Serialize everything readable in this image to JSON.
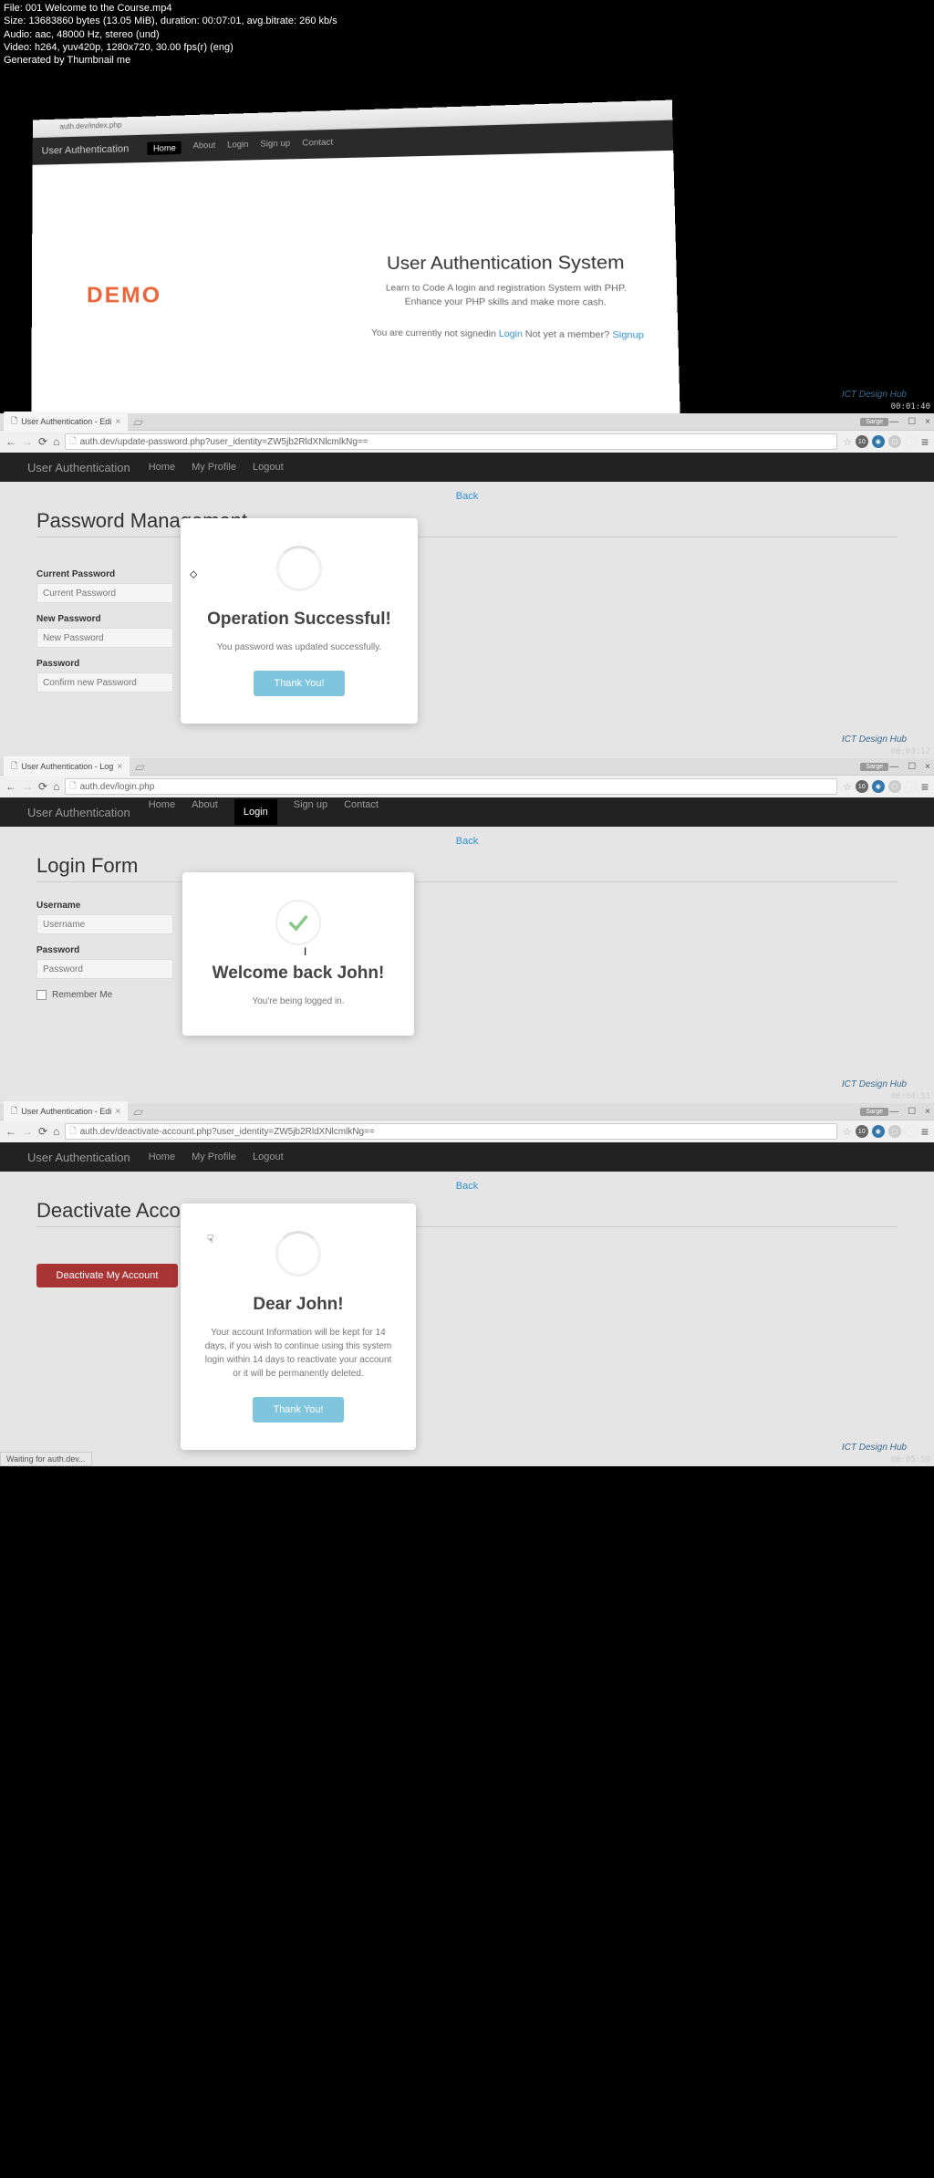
{
  "meta": {
    "file": "File: 001 Welcome to the Course.mp4",
    "size": "Size: 13683860 bytes (13.05 MiB), duration: 00:07:01, avg.bitrate: 260 kb/s",
    "audio": "Audio: aac, 48000 Hz, stereo (und)",
    "video": "Video: h264, yuv420p, 1280x720, 30.00 fps(r) (eng)",
    "gen": "Generated by Thumbnail me"
  },
  "frame1": {
    "url_suffix": "auth.dev/index.php",
    "brand": "User Authentication",
    "nav": {
      "home": "Home",
      "about": "About",
      "login": "Login",
      "signup": "Sign up",
      "contact": "Contact"
    },
    "demo": "DEMO",
    "title": "User Authentication System",
    "sub1": "Learn to Code A login and registration System with PHP.",
    "sub2": "Enhance your PHP skills and make more cash.",
    "status_pre": "You are currently not signedin ",
    "login_link": "Login",
    "status_mid": " Not yet a member? ",
    "signup_link": "Signup",
    "watermark": "ICT Design Hub",
    "timestamp": "00:01:40"
  },
  "frame2": {
    "tab_title": "User Authentication - Edi",
    "sarge": "Sarge",
    "url": "auth.dev/update-password.php?user_identity=ZW5jb2RldXNlcmlkNg==",
    "brand": "User Authentication",
    "nav": {
      "home": "Home",
      "profile": "My Profile",
      "logout": "Logout"
    },
    "back": "Back",
    "heading": "Password Management",
    "labels": {
      "current": "Current Password",
      "new": "New Password",
      "confirm": "Password"
    },
    "placeholders": {
      "current": "Current Password",
      "new": "New Password",
      "confirm": "Confirm new Password"
    },
    "modal": {
      "title": "Operation Successful!",
      "text": "You password was updated successfully.",
      "btn": "Thank You!"
    },
    "watermark": "ICT Design Hub",
    "timestamp": "00:03:12"
  },
  "frame3": {
    "tab_title": "User Authentication - Log",
    "sarge": "Sarge",
    "url": "auth.dev/login.php",
    "brand": "User Authentication",
    "nav": {
      "home": "Home",
      "about": "About",
      "login": "Login",
      "signup": "Sign up",
      "contact": "Contact"
    },
    "back": "Back",
    "heading": "Login Form",
    "labels": {
      "user": "Username",
      "pass": "Password",
      "remember": "Remember Me"
    },
    "placeholders": {
      "user": "Username",
      "pass": "Password"
    },
    "modal": {
      "title": "Welcome back John!",
      "text": "You're being logged in."
    },
    "watermark": "ICT Design Hub",
    "timestamp": "00:04:51"
  },
  "frame4": {
    "tab_title": "User Authentication - Edi",
    "sarge": "Sarge",
    "url": "auth.dev/deactivate-account.php?user_identity=ZW5jb2RldXNlcmlkNg==",
    "brand": "User Authentication",
    "nav": {
      "home": "Home",
      "profile": "My Profile",
      "logout": "Logout"
    },
    "back": "Back",
    "heading": "Deactivate Account",
    "btn": "Deactivate My Account",
    "modal": {
      "title": "Dear John!",
      "text": "Your account Information will be kept for 14 days, if you wish to continue using this system login within 14 days to reactivate your account or it will be permanently deleted.",
      "btn": "Thank You!"
    },
    "status": "Waiting for auth.dev...",
    "watermark": "ICT Design Hub",
    "timestamp": "00:05:59"
  }
}
